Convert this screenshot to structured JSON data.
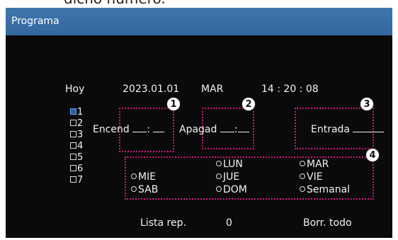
{
  "top_caption": "dicho número.",
  "window": {
    "title": "Programa"
  },
  "header": {
    "today_label": "Hoy",
    "date": "2023.01.01",
    "weekday": "MAR",
    "time": "14 : 20 : 08"
  },
  "schedule_slots": [
    "1",
    "2",
    "3",
    "4",
    "5",
    "6",
    "7"
  ],
  "fields": {
    "on_label": "Encend",
    "off_label": "Apagad",
    "input_label": "Entrada",
    "separator": ":"
  },
  "days": {
    "mon": "LUN",
    "tue": "MAR",
    "wed": "MIE",
    "thu": "JUE",
    "fri": "VIE",
    "sat": "SAB",
    "sun": "DOM",
    "weekly": "Semanal"
  },
  "callouts": [
    "1",
    "2",
    "3",
    "4"
  ],
  "footer": {
    "playlist_label": "Lista rep.",
    "playlist_value": "0",
    "clear_all_label": "Borr. todo"
  },
  "colors": {
    "titlebar": "#3a6fa5",
    "background": "#0a0a0a",
    "callout_border": "#d4147c"
  }
}
